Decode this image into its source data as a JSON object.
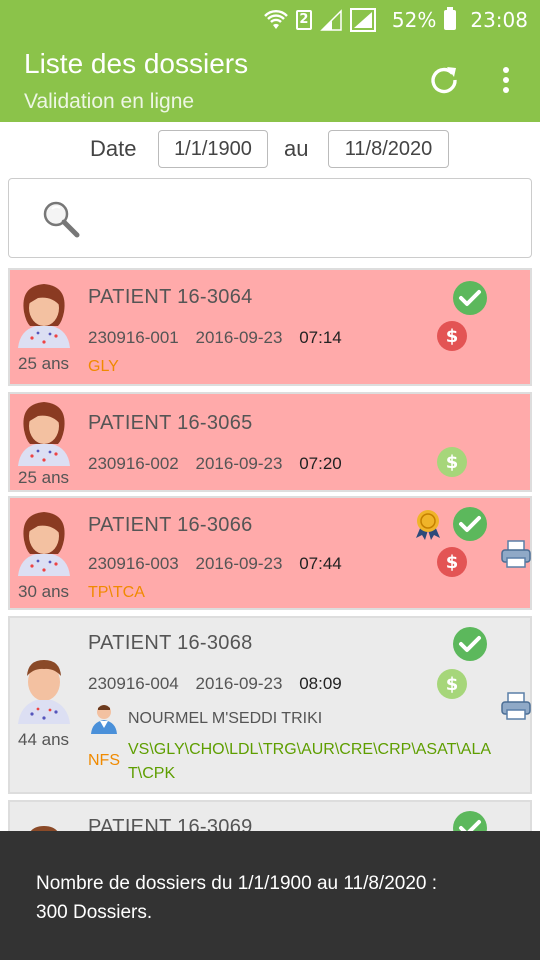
{
  "status_bar": {
    "battery": "52%",
    "time": "23:08",
    "sim_slot": "2"
  },
  "appbar": {
    "title": "Liste des dossiers",
    "subtitle": "Validation en ligne"
  },
  "date_filter": {
    "date_label": "Date",
    "from": "1/1/1900",
    "au_label": "au",
    "to": "11/8/2020"
  },
  "search": {
    "placeholder": ""
  },
  "dossiers": [
    {
      "name": "PATIENT 16-3064",
      "age": "25 ans",
      "id": "230916-001",
      "date": "2016-09-23",
      "time": "07:14",
      "tests": "GLY",
      "status": "pink",
      "validated": true,
      "paid": false,
      "award": false,
      "printable": false
    },
    {
      "name": "PATIENT 16-3065",
      "age": "25 ans",
      "id": "230916-002",
      "date": "2016-09-23",
      "time": "07:20",
      "tests": "",
      "status": "pink",
      "validated": false,
      "paid": true,
      "award": false,
      "printable": false
    },
    {
      "name": "PATIENT 16-3066",
      "age": "30 ans",
      "id": "230916-003",
      "date": "2016-09-23",
      "time": "07:44",
      "tests": "TP\\TCA",
      "status": "pink",
      "validated": true,
      "paid": false,
      "award": true,
      "printable": true
    },
    {
      "name": "PATIENT 16-3068",
      "age": "44 ans",
      "id": "230916-004",
      "date": "2016-09-23",
      "time": "08:09",
      "doctor": "NOURMEL M'SEDDI TRIKI",
      "nfs": "NFS",
      "tests_green": "VS\\GLY\\CHO\\LDL\\TRG\\AUR\\CRE\\CRP\\ASAT\\ALAT\\CPK",
      "status": "grey",
      "validated": true,
      "paid": true,
      "award": false,
      "printable": true
    },
    {
      "name": "PATIENT 16-3069",
      "status": "grey",
      "validated": true
    }
  ],
  "toast": {
    "message": "Nombre de dossiers du 1/1/1900 au 11/8/2020 : 300 Dossiers."
  },
  "colors": {
    "accent": "#8bc34a",
    "pink_row": "#ffaaaa",
    "grey_row": "#ebebeb",
    "check_green": "#5cb85c",
    "dollar_red": "#e35454",
    "dollar_green": "#a6d67a",
    "test_orange": "#f08a00",
    "test_green": "#5e9e00"
  },
  "icons": [
    "wifi-icon",
    "signal-icon",
    "battery-icon",
    "refresh-icon",
    "overflow-menu-icon",
    "search-icon",
    "female-patient-avatar",
    "male-patient-avatar",
    "check-icon",
    "dollar-icon",
    "award-icon",
    "printer-icon",
    "doctor-icon"
  ]
}
